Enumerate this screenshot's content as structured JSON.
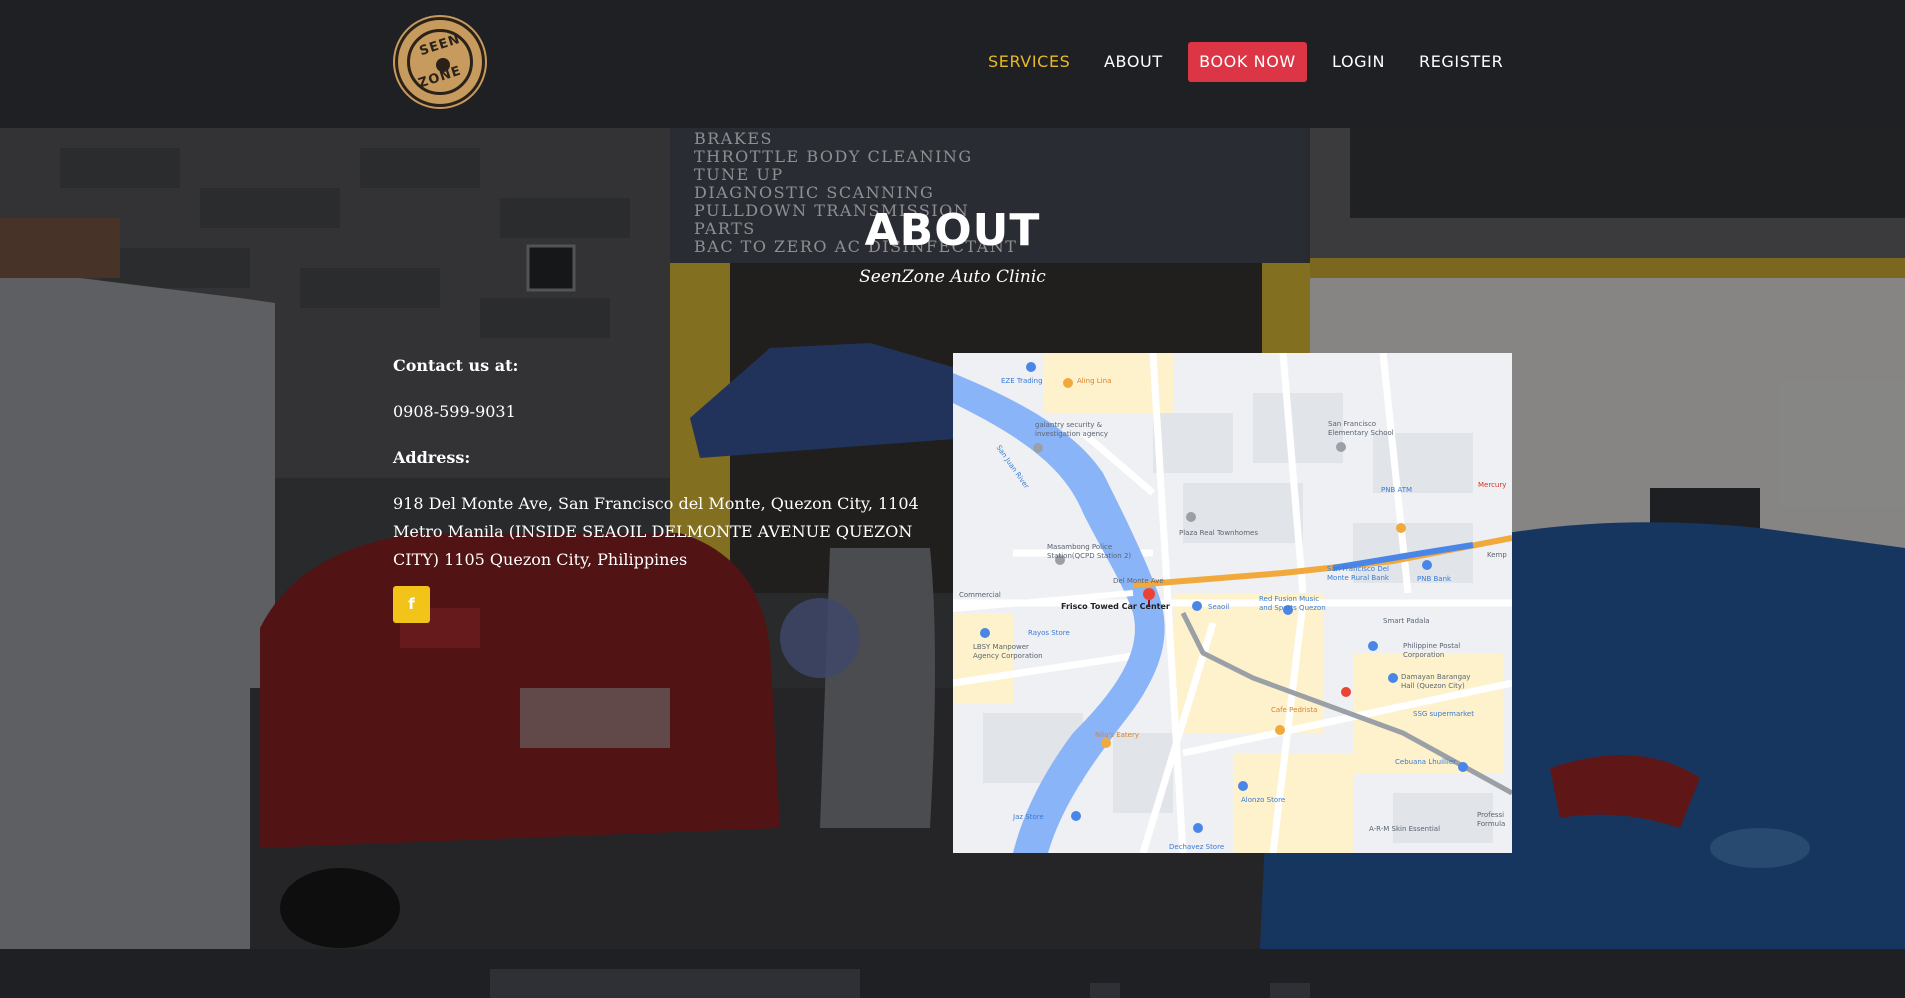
{
  "nav": {
    "services": "SERVICES",
    "about": "ABOUT",
    "book_now": "BOOK NOW",
    "login": "LOGIN",
    "register": "REGISTER"
  },
  "logo": {
    "line1": "SEEN",
    "line2": "ZONE"
  },
  "hero": {
    "title": "ABOUT",
    "subtitle": "SeenZone Auto Clinic",
    "banner_lines": [
      "BRAKES",
      "THROTTLE BODY CLEANING",
      "TUNE UP",
      "DIAGNOSTIC SCANNING",
      "PULLDOWN TRANSMISSION",
      "PARTS",
      "BAC TO ZERO AC DISINFECTANT"
    ]
  },
  "contact": {
    "contact_label": "Contact us at:",
    "phone": "0908-599-9031",
    "address_label": "Address:",
    "address": "918 Del Monte Ave, San Francisco del Monte, Quezon City, 1104 Metro Manila (INSIDE SEAOIL DELMONTE AVENUE QUEZON CITY) 1105 Quezon City, Philippines",
    "facebook_icon": "f"
  },
  "map": {
    "labels": {
      "eze": "EZE Trading",
      "aling": "Aling Lina",
      "galantry": "galantry security &",
      "galantry2": "investigation agency",
      "sanjuan": "San Juan River",
      "sfes": "San Francisco",
      "sfes2": "Elementary School",
      "pnb_atm": "PNB ATM",
      "mercury": "Mercury",
      "plaza": "Plaza Real Townhomes",
      "masambong": "Masambong Police",
      "masambong2": "Station(QCPD Station 2)",
      "delmonte": "Del Monte Ave",
      "frisco": "Frisco Towed Car Center",
      "commercial": "Commercial",
      "sfdm": "San Francisco Del",
      "sfdm2": "Monte Rural Bank",
      "pnb": "PNB Bank",
      "kemp": "Kemp",
      "seaoil": "Seaoil",
      "redfusion": "Red Fusion Music",
      "redfusion2": "and Sports Quezon",
      "rayos": "Rayos Store",
      "lbsy": "LBSY Manpower",
      "lbsy2": "Agency Corporation",
      "smart": "Smart Padala",
      "philpost": "Philippine Postal",
      "philpost2": "Corporation",
      "damayan": "Damayan Barangay",
      "damayan2": "Hall (Quezon City)",
      "ssg": "SSG supermarket",
      "cafe": "Cafe Pedrista",
      "nila": "Nila's Eatery",
      "cebuana": "Cebuana Lhuillier",
      "alonzo": "Alonzo Store",
      "jaz": "Jaz Store",
      "arm": "A-R-M Skin Essential",
      "dechavez": "Dechavez Store",
      "prof": "Professi",
      "formula": "Formula"
    }
  }
}
